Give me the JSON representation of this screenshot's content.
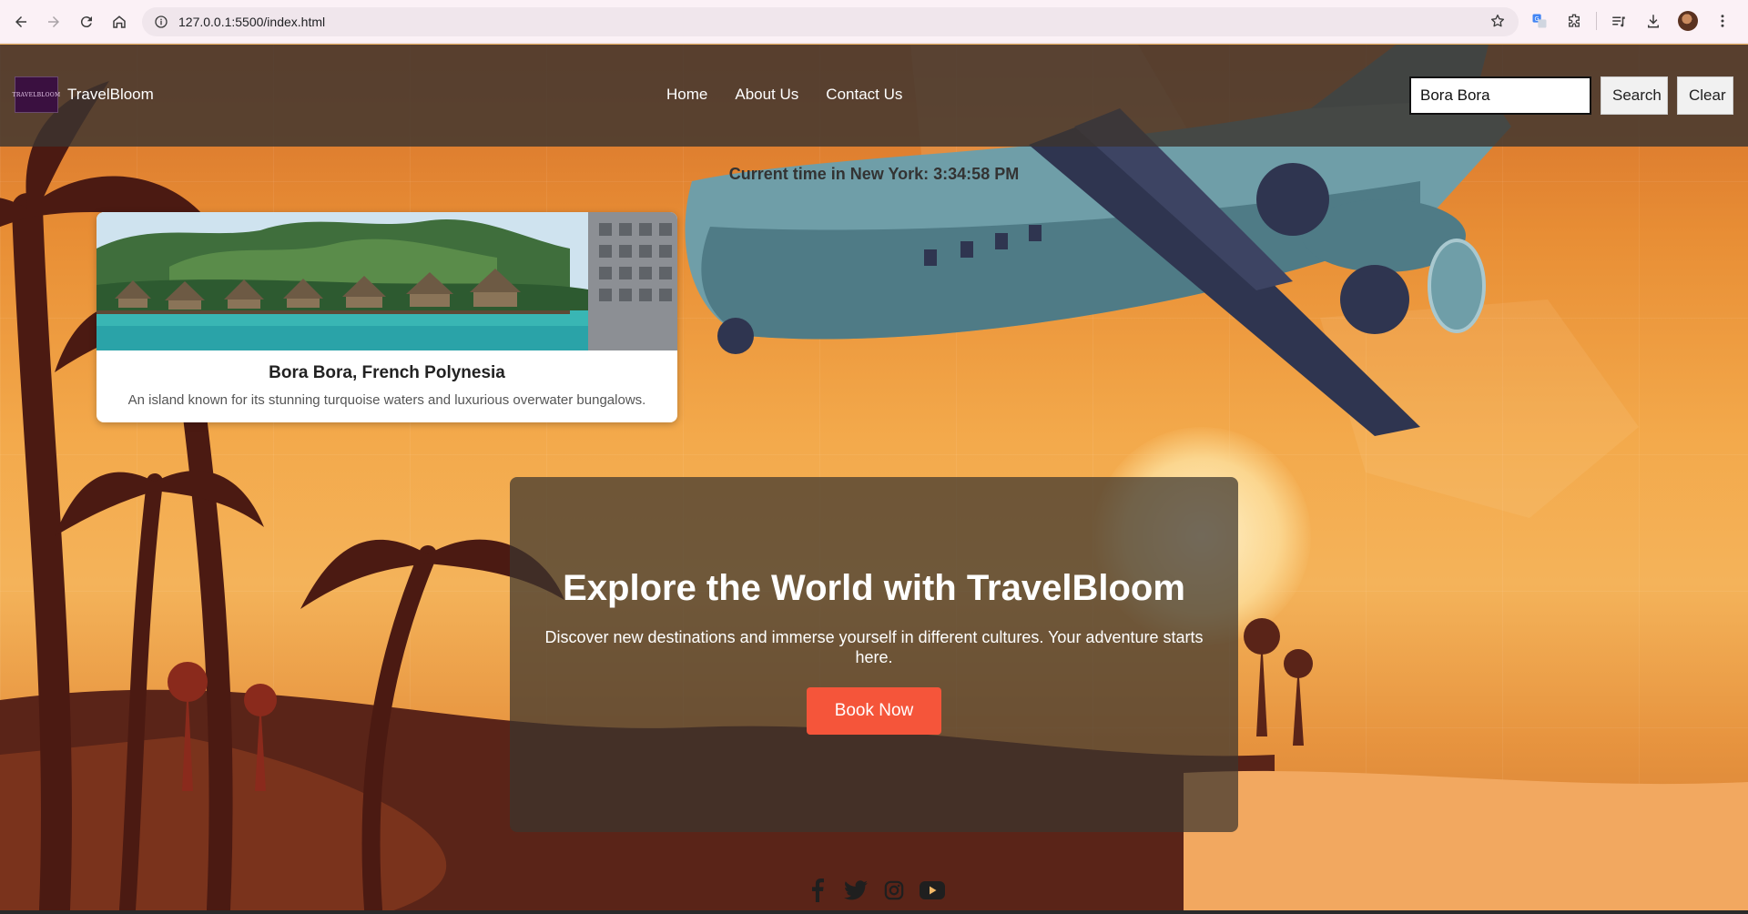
{
  "browser": {
    "url": "127.0.0.1:5500/index.html",
    "icons": [
      "back-icon",
      "forward-icon",
      "reload-icon",
      "home-icon",
      "site-info-icon",
      "bookmark-star-icon",
      "translate-icon",
      "extensions-icon",
      "reading-list-icon",
      "download-icon",
      "profile-avatar",
      "menu-icon"
    ]
  },
  "header": {
    "logo_text": "TRAVELBLOOM",
    "brand": "TravelBloom",
    "nav": [
      "Home",
      "About Us",
      "Contact Us"
    ],
    "search": {
      "value": "Bora Bora",
      "button": "Search",
      "clear": "Clear"
    }
  },
  "clock": {
    "label": "Current time in New York: 3:34:58 PM"
  },
  "result": {
    "title": "Bora Bora, French Polynesia",
    "description": "An island known for its stunning turquoise waters and luxurious overwater bungalows."
  },
  "hero": {
    "title": "Explore the World with TravelBloom",
    "subtitle": "Discover new destinations and immerse yourself in different cultures. Your adventure starts here.",
    "button": "Book Now"
  },
  "social": [
    "facebook-icon",
    "twitter-icon",
    "instagram-icon",
    "youtube-icon"
  ],
  "colors": {
    "accent": "#f5553a",
    "header_bg": "#3c3430",
    "hero_bg": "#3c342e"
  }
}
